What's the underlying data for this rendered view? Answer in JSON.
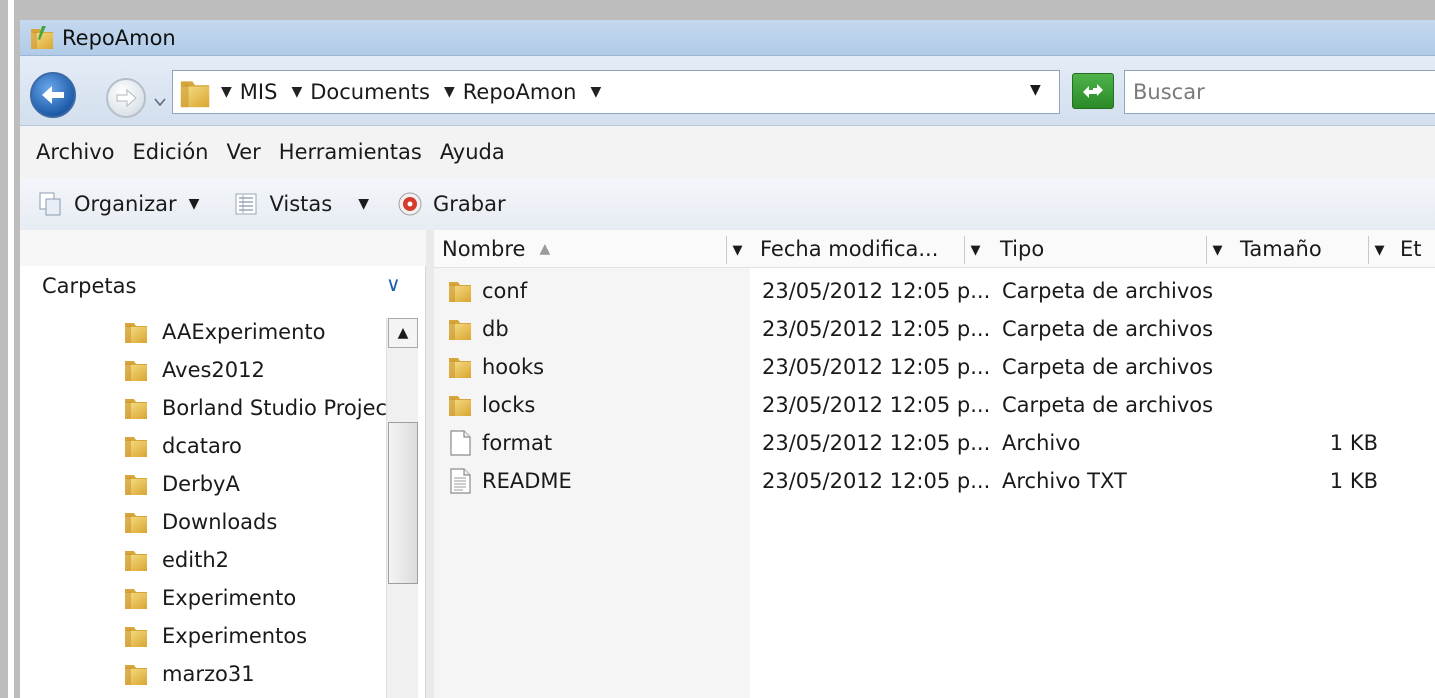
{
  "window": {
    "title": "RepoAmon"
  },
  "address": {
    "crumbs": [
      "MIS",
      "Documents",
      "RepoAmon"
    ],
    "search_placeholder": "Buscar"
  },
  "menu": [
    "Archivo",
    "Edición",
    "Ver",
    "Herramientas",
    "Ayuda"
  ],
  "toolbar": {
    "organize": "Organizar",
    "views": "Vistas",
    "burn": "Grabar"
  },
  "nav_pane": {
    "title": "Carpetas",
    "folders": [
      "AAExperimento",
      "Aves2012",
      "Borland Studio Projects",
      "dcataro",
      "DerbyA",
      "Downloads",
      "edith2",
      "Experimento",
      "Experimentos",
      "marzo31"
    ]
  },
  "columns": {
    "name": "Nombre",
    "date": "Fecha modifica...",
    "type": "Tipo",
    "size": "Tamaño",
    "tags": "Et"
  },
  "files": [
    {
      "name": "conf",
      "date": "23/05/2012 12:05 p...",
      "type": "Carpeta de archivos",
      "size": "",
      "icon": "folder-icon"
    },
    {
      "name": "db",
      "date": "23/05/2012 12:05 p...",
      "type": "Carpeta de archivos",
      "size": "",
      "icon": "folder-icon"
    },
    {
      "name": "hooks",
      "date": "23/05/2012 12:05 p...",
      "type": "Carpeta de archivos",
      "size": "",
      "icon": "folder-icon"
    },
    {
      "name": "locks",
      "date": "23/05/2012 12:05 p...",
      "type": "Carpeta de archivos",
      "size": "",
      "icon": "folder-icon"
    },
    {
      "name": "format",
      "date": "23/05/2012 12:05 p...",
      "type": "Archivo",
      "size": "1 KB",
      "icon": "blank-file-icon"
    },
    {
      "name": "README",
      "date": "23/05/2012 12:05 p...",
      "type": "Archivo TXT",
      "size": "1 KB",
      "icon": "text-file-icon"
    }
  ],
  "colors": {
    "titlebar": "#b9d0ea",
    "folder": "#e8c24a",
    "accent": "#1f5ca9"
  }
}
